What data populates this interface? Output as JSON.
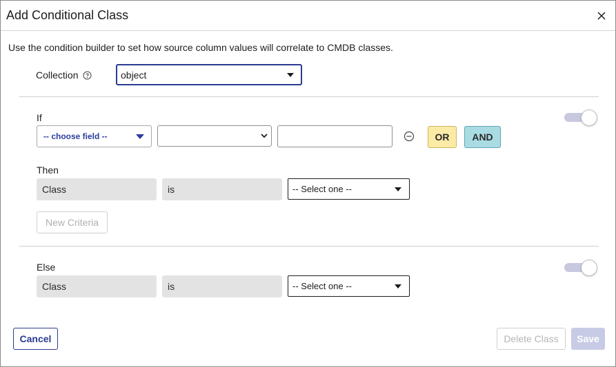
{
  "dialog": {
    "title": "Add Conditional Class",
    "description": "Use the condition builder to set how source column values will correlate to CMDB classes."
  },
  "collection": {
    "label": "Collection",
    "value": "object"
  },
  "if_section": {
    "label": "If",
    "field_placeholder": "-- choose field --",
    "operator_value": "",
    "value_input": "",
    "or_label": "OR",
    "and_label": "AND",
    "toggle_on": true
  },
  "then_section": {
    "label": "Then",
    "field": "Class",
    "operator": "is",
    "select_value": "-- Select one --",
    "new_criteria_label": "New Criteria"
  },
  "else_section": {
    "label": "Else",
    "field": "Class",
    "operator": "is",
    "select_value": "-- Select one --",
    "toggle_on": true
  },
  "footer": {
    "cancel_label": "Cancel",
    "delete_label": "Delete Class",
    "save_label": "Save"
  },
  "colors": {
    "primary": "#2b3a8f",
    "or_button": "#fbeba6",
    "and_button": "#a9dbe2",
    "readonly_fill": "#e3e3e3",
    "toggle_track": "#c8c8e0"
  },
  "icons": {
    "close": "close-icon",
    "help": "help-circle-icon",
    "remove_condition": "minus-circle-icon"
  }
}
